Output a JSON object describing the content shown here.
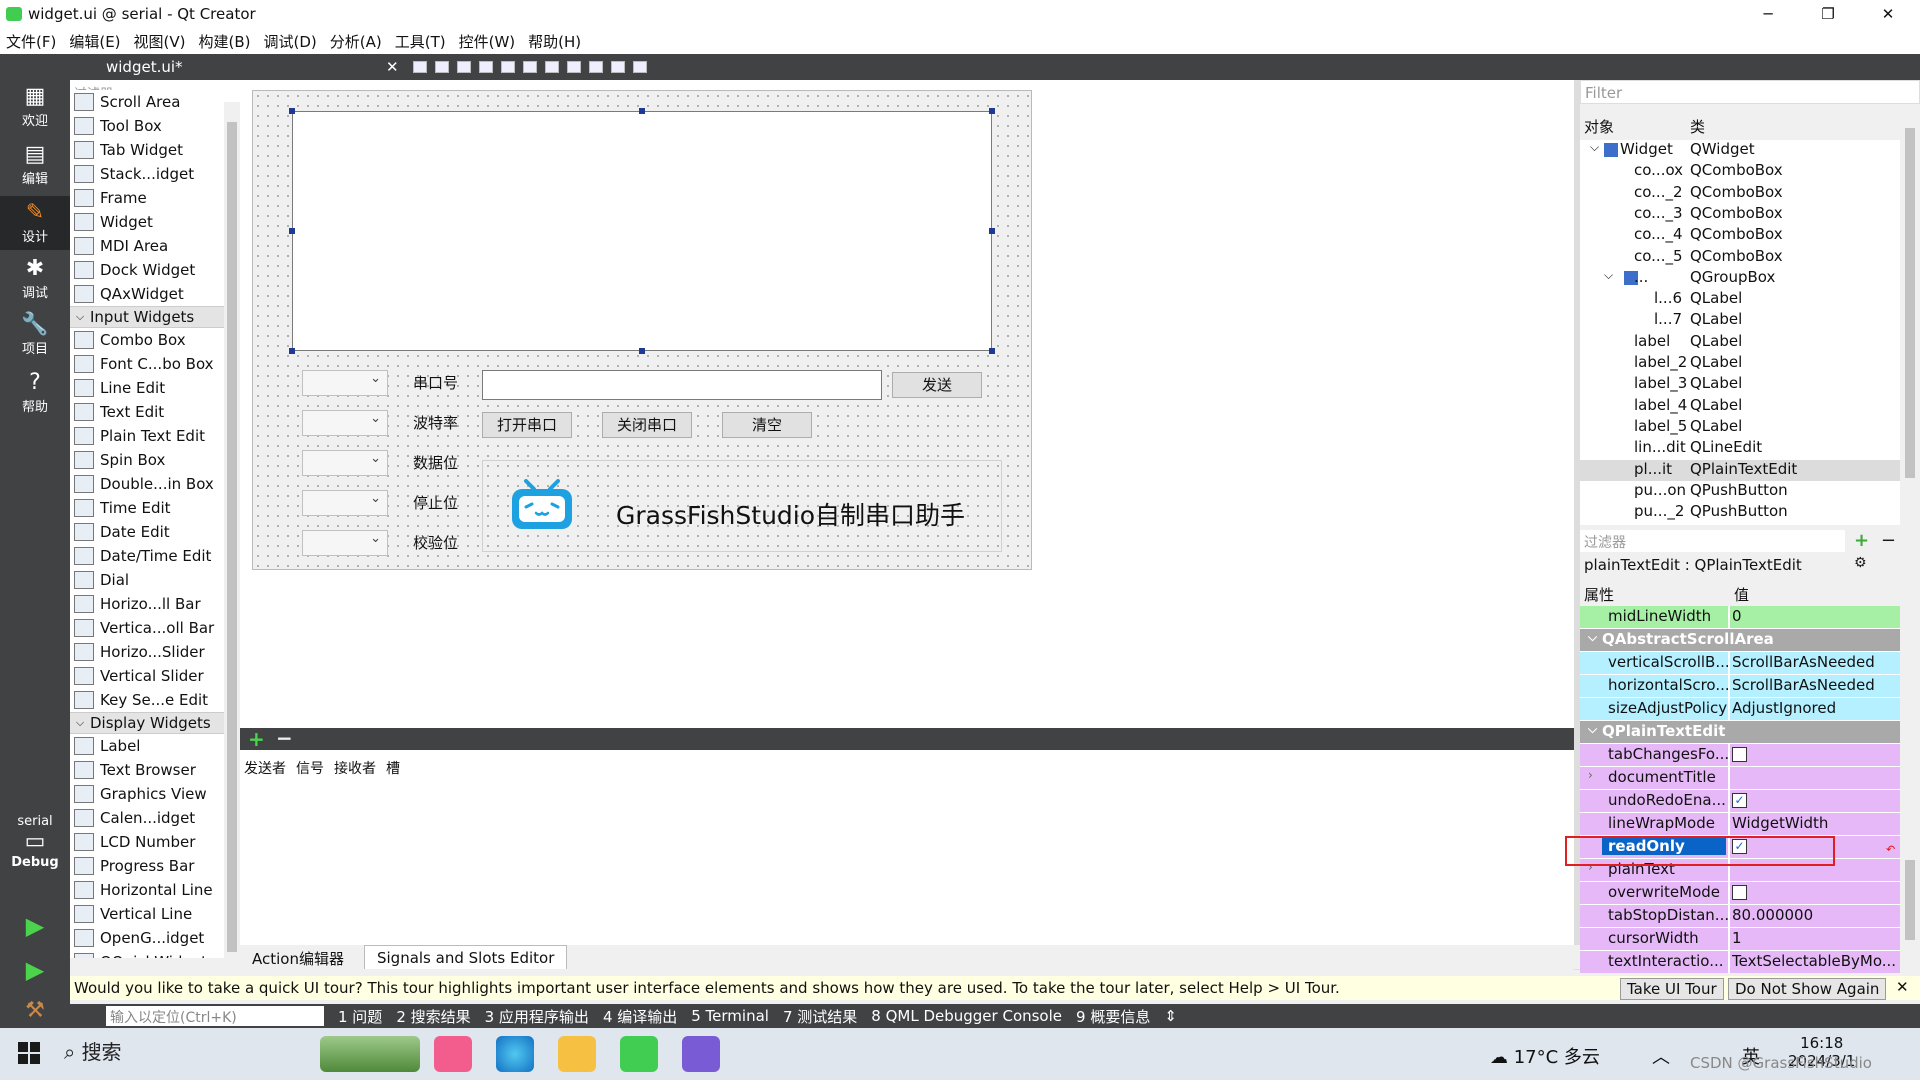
{
  "window": {
    "title": "widget.ui @ serial - Qt Creator",
    "min": "─",
    "max": "❐",
    "close": "✕"
  },
  "menu": [
    "文件(F)",
    "编辑(E)",
    "视图(V)",
    "构建(B)",
    "调试(D)",
    "分析(A)",
    "工具(T)",
    "控件(W)",
    "帮助(H)"
  ],
  "modes": [
    {
      "label": "欢迎",
      "icon": "▦"
    },
    {
      "label": "编辑",
      "icon": "▤"
    },
    {
      "label": "设计",
      "icon": "✎"
    },
    {
      "label": "调试",
      "icon": "✱"
    },
    {
      "label": "项目",
      "icon": "🔧"
    },
    {
      "label": "帮助",
      "icon": "?"
    }
  ],
  "kit": {
    "project": "serial",
    "config": "Debug"
  },
  "toolbar": {
    "file": "widget.ui*"
  },
  "widget_box": {
    "filter": "过滤器",
    "items": [
      {
        "t": "item",
        "label": "Scroll Area"
      },
      {
        "t": "item",
        "label": "Tool Box"
      },
      {
        "t": "item",
        "label": "Tab Widget"
      },
      {
        "t": "item",
        "label": "Stack...idget"
      },
      {
        "t": "item",
        "label": "Frame"
      },
      {
        "t": "item",
        "label": "Widget"
      },
      {
        "t": "item",
        "label": "MDI Area"
      },
      {
        "t": "item",
        "label": "Dock Widget"
      },
      {
        "t": "item",
        "label": "QAxWidget"
      },
      {
        "t": "cat",
        "label": "Input Widgets"
      },
      {
        "t": "item",
        "label": "Combo Box"
      },
      {
        "t": "item",
        "label": "Font C...bo Box"
      },
      {
        "t": "item",
        "label": "Line Edit"
      },
      {
        "t": "item",
        "label": "Text Edit"
      },
      {
        "t": "item",
        "label": "Plain Text Edit"
      },
      {
        "t": "item",
        "label": "Spin Box"
      },
      {
        "t": "item",
        "label": "Double...in Box"
      },
      {
        "t": "item",
        "label": "Time Edit"
      },
      {
        "t": "item",
        "label": "Date Edit"
      },
      {
        "t": "item",
        "label": "Date/Time Edit"
      },
      {
        "t": "item",
        "label": "Dial"
      },
      {
        "t": "item",
        "label": "Horizo...ll Bar"
      },
      {
        "t": "item",
        "label": "Vertica...oll Bar"
      },
      {
        "t": "item",
        "label": "Horizo...Slider"
      },
      {
        "t": "item",
        "label": "Vertical Slider"
      },
      {
        "t": "item",
        "label": "Key Se...e Edit"
      },
      {
        "t": "cat",
        "label": "Display Widgets"
      },
      {
        "t": "item",
        "label": "Label"
      },
      {
        "t": "item",
        "label": "Text Browser"
      },
      {
        "t": "item",
        "label": "Graphics View"
      },
      {
        "t": "item",
        "label": "Calen...idget"
      },
      {
        "t": "item",
        "label": "LCD Number"
      },
      {
        "t": "item",
        "label": "Progress Bar"
      },
      {
        "t": "item",
        "label": "Horizontal Line"
      },
      {
        "t": "item",
        "label": "Vertical Line"
      },
      {
        "t": "item",
        "label": "OpenG...idget"
      },
      {
        "t": "item",
        "label": "QQuickWidget"
      }
    ]
  },
  "form": {
    "labels": [
      "串口号",
      "波特率",
      "数据位",
      "停止位",
      "校验位"
    ],
    "send": "发送",
    "open": "打开串口",
    "close": "关闭串口",
    "clear": "清空",
    "brand": "GrassFishStudio自制串口助手"
  },
  "signals": {
    "cols": [
      "发送者",
      "信号",
      "接收者",
      "槽"
    ],
    "tabs": [
      "Action编辑器",
      "Signals and Slots Editor"
    ]
  },
  "object_inspector": {
    "filter": "Filter",
    "col_obj": "对象",
    "col_cls": "类",
    "rows": [
      {
        "n": "Widget",
        "c": "QWidget",
        "ind": 0,
        "exp": "⌵"
      },
      {
        "n": "co...ox",
        "c": "QComboBox",
        "ind": 1
      },
      {
        "n": "co..._2",
        "c": "QComboBox",
        "ind": 1
      },
      {
        "n": "co..._3",
        "c": "QComboBox",
        "ind": 1
      },
      {
        "n": "co..._4",
        "c": "QComboBox",
        "ind": 1
      },
      {
        "n": "co..._5",
        "c": "QComboBox",
        "ind": 1
      },
      {
        "n": "...",
        "c": "QGroupBox",
        "ind": 1,
        "exp": "⌵"
      },
      {
        "n": "l...6",
        "c": "QLabel",
        "ind": 2
      },
      {
        "n": "l...7",
        "c": "QLabel",
        "ind": 2
      },
      {
        "n": "label",
        "c": "QLabel",
        "ind": 1
      },
      {
        "n": "label_2",
        "c": "QLabel",
        "ind": 1
      },
      {
        "n": "label_3",
        "c": "QLabel",
        "ind": 1
      },
      {
        "n": "label_4",
        "c": "QLabel",
        "ind": 1
      },
      {
        "n": "label_5",
        "c": "QLabel",
        "ind": 1
      },
      {
        "n": "lin...dit",
        "c": "QLineEdit",
        "ind": 1
      },
      {
        "n": "pl...it",
        "c": "QPlainTextEdit",
        "ind": 1,
        "sel": true
      },
      {
        "n": "pu...on",
        "c": "QPushButton",
        "ind": 1
      },
      {
        "n": "pu..._2",
        "c": "QPushButton",
        "ind": 1
      }
    ]
  },
  "property_editor": {
    "filter": "过滤器",
    "title": "plainTextEdit : QPlainTextEdit",
    "col_prop": "属性",
    "col_val": "值",
    "rows": [
      {
        "k": "grn",
        "n": "midLineWidth",
        "v": "0"
      },
      {
        "k": "cat",
        "n": "QAbstractScrollArea"
      },
      {
        "k": "cyn",
        "n": "verticalScrollB...",
        "v": "ScrollBarAsNeeded"
      },
      {
        "k": "cyn",
        "n": "horizontalScro...",
        "v": "ScrollBarAsNeeded"
      },
      {
        "k": "cyn",
        "n": "sizeAdjustPolicy",
        "v": "AdjustIgnored"
      },
      {
        "k": "cat",
        "n": "QPlainTextEdit"
      },
      {
        "k": "prp",
        "n": "tabChangesFo...",
        "chk": false
      },
      {
        "k": "prp",
        "n": "documentTitle",
        "v": "",
        "arr": true
      },
      {
        "k": "prp",
        "n": "undoRedoEna...",
        "chk": true
      },
      {
        "k": "prp",
        "n": "lineWrapMode",
        "v": "WidgetWidth"
      },
      {
        "k": "prp",
        "n": "readOnly",
        "chk": true,
        "hl": true
      },
      {
        "k": "prp",
        "n": "plainText",
        "v": "",
        "arr": true
      },
      {
        "k": "prp",
        "n": "overwriteMode",
        "chk": false
      },
      {
        "k": "prp",
        "n": "tabStopDistan...",
        "v": "80.000000"
      },
      {
        "k": "prp",
        "n": "cursorWidth",
        "v": "1"
      },
      {
        "k": "prp",
        "n": "textInteractio...",
        "v": "TextSelectableByMo..."
      }
    ]
  },
  "tour": {
    "message": "Would you like to take a quick UI tour? This tour highlights important user interface elements and shows how they are used. To take the tour later, select Help > UI Tour.",
    "take": "Take UI Tour",
    "dont": "Do Not Show Again"
  },
  "output": {
    "locator": "输入以定位(Ctrl+K)",
    "tabs": [
      "1 问题",
      "2 搜索结果",
      "3 应用程序输出",
      "4 编译输出",
      "5 Terminal",
      "7 测试结果",
      "8 QML Debugger Console",
      "9 概要信息"
    ]
  },
  "taskbar": {
    "search": "搜索",
    "weather": "17°C 多云",
    "ime": "英",
    "time": "16:18",
    "date": "2024/3/1",
    "watermark": "CSDN @GrassFishStudio"
  },
  "colors": {
    "dark": "#404244",
    "highlight": "#0a64c8",
    "green_row": "#a6f0a6",
    "cyan_row": "#b4f0ff",
    "purple_row": "#e6b8f8"
  }
}
